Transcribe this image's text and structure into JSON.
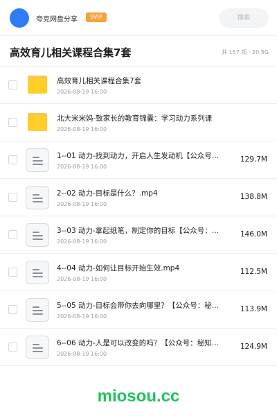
{
  "header": {
    "username": "夸克网盘分享",
    "badge": "SVIP",
    "search_placeholder": "搜索"
  },
  "title_row": {
    "title": "高效育儿相关课程合集7套",
    "summary": "共 157 项 · 20.5G"
  },
  "items": [
    {
      "type": "folder",
      "name": "高效育儿相关课程合集7套",
      "date": "2026-08-19 16:00",
      "size": ""
    },
    {
      "type": "folder",
      "name": "北大米米妈-致家长的教育锦囊：学习动力系列课",
      "date": "2026-08-19 16:00",
      "size": ""
    },
    {
      "type": "file",
      "name": "1--01 动力-找到动力，开启人生发动机【公众号…",
      "date": "2026-08-19 16:00",
      "size": "129.7M"
    },
    {
      "type": "file",
      "name": "2--02 动力-目标是什么？.mp4",
      "date": "2026-08-19 16:00",
      "size": "138.8M"
    },
    {
      "type": "file",
      "name": "3--03 动力-拿起纸笔，制定你的目标【公众号：…",
      "date": "2026-08-19 16:00",
      "size": "146.0M"
    },
    {
      "type": "file",
      "name": "4--04 动力-如何让目标开始生效.mp4",
      "date": "2026-08-19 16:00",
      "size": "112.5M"
    },
    {
      "type": "file",
      "name": "5--05 动力-目标会带你去向哪里？【公众号：秘…",
      "date": "2026-08-19 16:00",
      "size": "113.9M"
    },
    {
      "type": "file",
      "name": "6--06 动力-人是可以改变的吗？【公众号：秘知…",
      "date": "2026-08-19 16:00",
      "size": "124.9M"
    }
  ],
  "watermark": "miosou.cc",
  "colors": {
    "accent": "#2f7cf6",
    "badge": "#f6a23c",
    "folder": "#ffcf27",
    "watermark": "#21c25c"
  },
  "icons": {
    "folder": "folder-icon",
    "file": "document-icon"
  }
}
